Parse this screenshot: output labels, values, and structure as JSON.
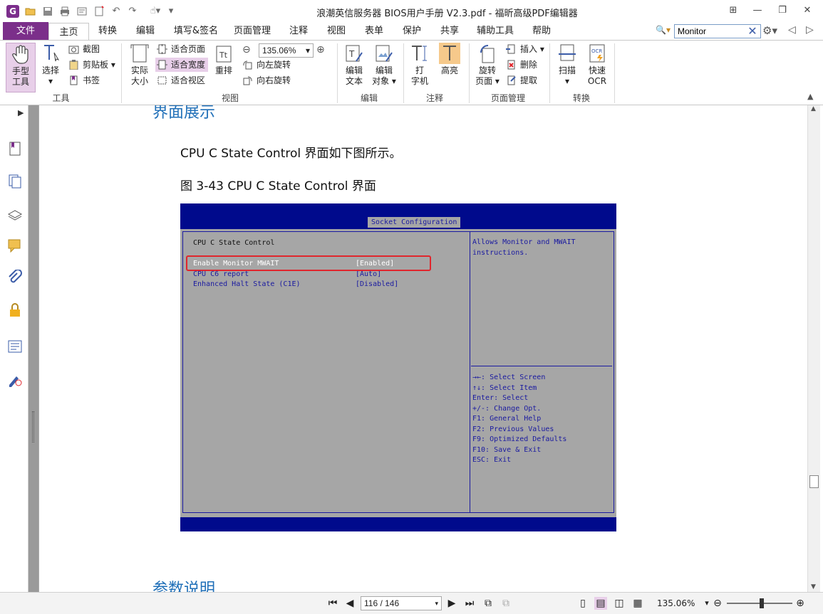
{
  "window": {
    "title": "浪潮英信服务器 BIOS用户手册 V2.3.pdf - 福昕高级PDF编辑器",
    "app_icon": "G"
  },
  "tabs": {
    "file": "文件",
    "items": [
      "主页",
      "转换",
      "编辑",
      "填写&签名",
      "页面管理",
      "注释",
      "视图",
      "表单",
      "保护",
      "共享",
      "辅助工具",
      "帮助"
    ]
  },
  "search": {
    "value": "Monitor"
  },
  "ribbon": {
    "tools": {
      "hand": "手型工具",
      "hand_l1": "手型",
      "hand_l2": "工具",
      "select": "选择",
      "screenshot": "截图",
      "clipboard": "剪贴板",
      "bookmark": "书签",
      "label": "工具"
    },
    "view": {
      "actual_l1": "实际",
      "actual_l2": "大小",
      "fit_page": "适合页面",
      "fit_width": "适合宽度",
      "fit_view": "适合视区",
      "reflow": "重排",
      "zoom": "135.06%",
      "rotate_left": "向左旋转",
      "rotate_right": "向右旋转",
      "label": "视图"
    },
    "edit": {
      "edit_text_l1": "编辑",
      "edit_text_l2": "文本",
      "edit_obj_l1": "编辑",
      "edit_obj_l2": "对象",
      "label": "编辑"
    },
    "comment": {
      "typewriter_l1": "打",
      "typewriter_l2": "字机",
      "highlight": "高亮",
      "label": "注释"
    },
    "pages": {
      "rotate_l1": "旋转",
      "rotate_l2": "页面",
      "insert": "插入",
      "delete": "删除",
      "extract": "提取",
      "label": "页面管理"
    },
    "convert": {
      "scan": "扫描",
      "ocr_l1": "快速",
      "ocr_l2": "OCR",
      "label": "转换"
    }
  },
  "document": {
    "heading_top": "界面展示",
    "intro": "CPU C State Control 界面如下图所示。",
    "caption": "图 3-43 CPU C State Control 界面",
    "heading_bottom": "参数说明",
    "bios": {
      "tab": "Socket Configuration",
      "section": "CPU C State Control",
      "rows": [
        {
          "name": "Enable Monitor MWAIT",
          "value": "[Enabled]"
        },
        {
          "name": "CPU C6 report",
          "value": "[Auto]"
        },
        {
          "name": "Enhanced Halt State (C1E)",
          "value": "[Disabled]"
        }
      ],
      "help": [
        "Allows Monitor and MWAIT",
        "instructions."
      ],
      "keys": [
        "→←: Select Screen",
        "↑↓: Select Item",
        "Enter: Select",
        "+/-: Change Opt.",
        "F1: General Help",
        "F2: Previous Values",
        "F9: Optimized Defaults",
        "F10: Save & Exit",
        "ESC: Exit"
      ]
    }
  },
  "status": {
    "page": "116 / 146",
    "zoom": "135.06%"
  },
  "colors": {
    "accent": "#7b2f8a",
    "heading": "#1f6fb8",
    "bios_blue": "#000a8c",
    "bios_gray": "#a6a6a6",
    "highlight_box": "#e0262d"
  }
}
